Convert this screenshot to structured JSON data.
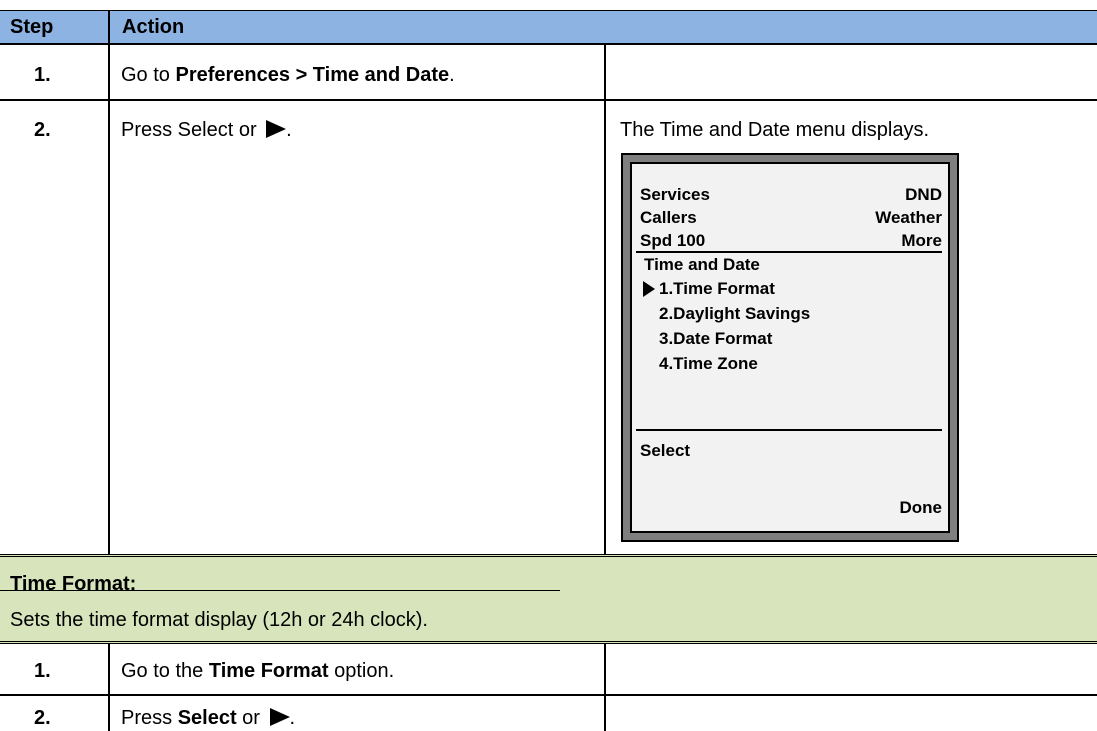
{
  "header": {
    "step": "Step",
    "action": "Action"
  },
  "rows": [
    {
      "step": "1.",
      "parts": [
        "Go to ",
        "Preferences > Time and Date",
        "."
      ]
    },
    {
      "step": "2.",
      "parts": [
        "Press Select or ",
        "."
      ],
      "result": "The Time and Date menu displays."
    }
  ],
  "phone": {
    "left_keys": [
      "Services",
      "Callers",
      "Spd 100"
    ],
    "right_keys": [
      "DND",
      "Weather",
      "More"
    ],
    "menu_title": "Time and Date",
    "menu_items": [
      "1.Time Format",
      "2.Daylight Savings",
      "3.Date Format",
      "4.Time Zone"
    ],
    "softkey_left": "Select",
    "softkey_right": "Done"
  },
  "section": {
    "title": "Time Format:",
    "description": "Sets the time format display (12h or 24h clock)."
  },
  "rows2": [
    {
      "step": "1.",
      "parts": [
        "Go to the ",
        "Time Format",
        " option."
      ]
    },
    {
      "step": "2.",
      "parts": [
        "Press ",
        "Select",
        " or ",
        "."
      ]
    }
  ],
  "colors": {
    "header_bg": "#8db3e2",
    "section_bg": "#d7e4bc",
    "screen_bg": "#f2f2f2",
    "bezel": "#7f7f7f"
  }
}
